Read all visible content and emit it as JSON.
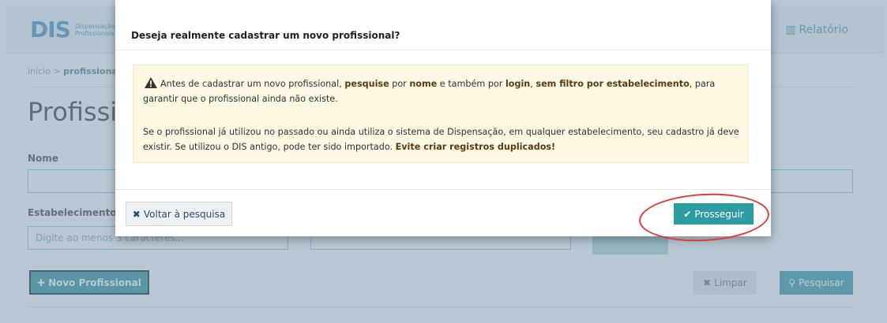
{
  "app": {
    "logo_mark": "DIS",
    "logo_text_line1": "Dispensação",
    "logo_text_line2": "Profissionais",
    "nav_report": "Relatório",
    "breadcrumb_home": "início",
    "breadcrumb_sep": " > ",
    "breadcrumb_current": "profissionais",
    "page_title": "Profissionais",
    "labels": {
      "name": "Nome",
      "establishment": "Estabelecimento"
    },
    "establishment_placeholder": "Digite ao menos 3 caracteres...",
    "buttons": {
      "new_professional": "Novo Profissional",
      "clear": "Limpar",
      "search": "Pesquisar"
    }
  },
  "modal": {
    "title": "Deseja realmente cadastrar um novo profissional?",
    "alert": {
      "p1": [
        {
          "t": "Antes de cadastrar um novo profissional, ",
          "b": false
        },
        {
          "t": "pesquise",
          "b": true
        },
        {
          "t": " por ",
          "b": false
        },
        {
          "t": "nome",
          "b": true
        },
        {
          "t": " e também por ",
          "b": false
        },
        {
          "t": "login",
          "b": true
        },
        {
          "t": ", ",
          "b": false
        },
        {
          "t": "sem filtro por estabelecimento",
          "b": true
        },
        {
          "t": ", para garantir que o profissional ainda não existe.",
          "b": false
        }
      ],
      "p2": [
        {
          "t": "Se o profissional já utilizou no passado ou ainda utiliza o sistema de Dispensação, em qualquer estabelecimento, seu cadastro já deve existir. Se utilizou o DIS antigo, pode ter sido importado. ",
          "b": false
        },
        {
          "t": "Evite criar registros duplicados!",
          "b": true
        }
      ]
    },
    "back_button": "Voltar à pesquisa",
    "proceed_button": "Prosseguir"
  },
  "colors": {
    "primary": "#2c9ca3",
    "warning_bg": "#fcf8e3",
    "highlight": "#e03b3b"
  },
  "icons": {
    "warning": "warning-triangle-icon",
    "close": "times-icon",
    "check": "check-icon",
    "plus": "plus-icon",
    "search": "search-icon",
    "report": "chart-icon"
  }
}
